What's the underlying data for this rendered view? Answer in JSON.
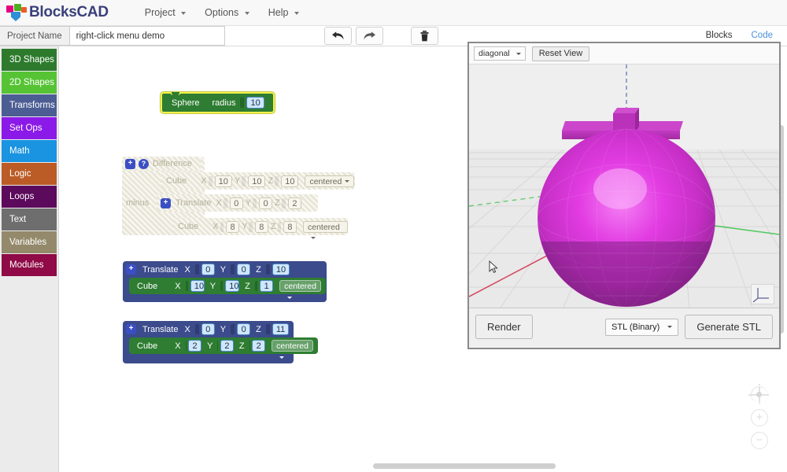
{
  "app": {
    "name": "BlocksCAD",
    "logo_icon": "blockscad-logo-icon"
  },
  "menubar": {
    "items": [
      {
        "label": "Project",
        "icon": "chevron-down-icon"
      },
      {
        "label": "Options",
        "icon": "chevron-down-icon"
      },
      {
        "label": "Help",
        "icon": "chevron-down-icon"
      }
    ]
  },
  "subbar": {
    "project_name_label": "Project Name",
    "project_name_value": "right-click menu demo",
    "project_name_placeholder": "Project Name",
    "tools": [
      {
        "name": "undo-button",
        "icon": "undo-arrow-icon"
      },
      {
        "name": "redo-button",
        "icon": "redo-arrow-icon"
      },
      {
        "name": "delete-button",
        "icon": "trash-icon"
      }
    ],
    "tabs": [
      {
        "label": "Blocks",
        "active": true
      },
      {
        "label": "Code",
        "active": false
      }
    ]
  },
  "palette": {
    "categories": [
      {
        "label": "3D Shapes",
        "color": "#2d7a2d"
      },
      {
        "label": "2D Shapes",
        "color": "#56c335"
      },
      {
        "label": "Transforms",
        "color": "#4b5d93"
      },
      {
        "label": "Set Ops",
        "color": "#8b1ae8"
      },
      {
        "label": "Math",
        "color": "#1a93e0"
      },
      {
        "label": "Logic",
        "color": "#bb5c26"
      },
      {
        "label": "Loops",
        "color": "#5c0a5c"
      },
      {
        "label": "Text",
        "color": "#6e6e6e"
      },
      {
        "label": "Variables",
        "color": "#94896b"
      },
      {
        "label": "Modules",
        "color": "#8f0a46"
      }
    ]
  },
  "workspace": {
    "sphere_block": {
      "name": "Sphere",
      "param_label": "radius",
      "radius": "10",
      "selected": true
    },
    "difference_block": {
      "name": "Difference",
      "disabled": true,
      "mutator_icon": "plus-icon",
      "help_icon": "question-icon",
      "minus_label": "minus",
      "first_cube": {
        "name": "Cube",
        "x_label": "X",
        "x": "10",
        "y_label": "Y",
        "y": "10",
        "z_label": "Z",
        "z": "10",
        "centered": "centered"
      },
      "translate": {
        "name": "Translate",
        "mutator_icon": "plus-icon",
        "x_label": "X",
        "x": "0",
        "y_label": "Y",
        "y": "0",
        "z_label": "Z",
        "z": "2"
      },
      "second_cube": {
        "name": "Cube",
        "x_label": "X",
        "x": "8",
        "y_label": "Y",
        "y": "8",
        "z_label": "Z",
        "z": "8",
        "centered": "centered"
      }
    },
    "translate_group_1": {
      "translate": {
        "name": "Translate",
        "mutator_icon": "plus-icon",
        "x_label": "X",
        "x": "0",
        "y_label": "Y",
        "y": "0",
        "z_label": "Z",
        "z": "10"
      },
      "cube": {
        "name": "Cube",
        "x_label": "X",
        "x": "10",
        "y_label": "Y",
        "y": "10",
        "z_label": "Z",
        "z": "1",
        "centered": "centered"
      }
    },
    "translate_group_2": {
      "translate": {
        "name": "Translate",
        "mutator_icon": "plus-icon",
        "x_label": "X",
        "x": "0",
        "y_label": "Y",
        "y": "0",
        "z_label": "Z",
        "z": "11"
      },
      "cube": {
        "name": "Cube",
        "x_label": "X",
        "x": "2",
        "y_label": "Y",
        "y": "2",
        "z_label": "Z",
        "z": "2",
        "centered": "centered"
      }
    },
    "zoom_controls": [
      {
        "name": "zoom-center-button",
        "icon": "target-icon",
        "glyph": ""
      },
      {
        "name": "zoom-in-button",
        "icon": "plus-icon",
        "glyph": "+"
      },
      {
        "name": "zoom-out-button",
        "icon": "minus-icon",
        "glyph": "−"
      }
    ]
  },
  "viewer": {
    "view_select": "diagonal",
    "reset_view_label": "Reset View",
    "render_label": "Render",
    "stl_format": "STL (Binary)",
    "generate_stl_label": "Generate STL",
    "model_color": "#d63fd6",
    "axis_indicator_icon": "axis-indicator-icon",
    "cursor_icon": "mouse-cursor-icon"
  }
}
